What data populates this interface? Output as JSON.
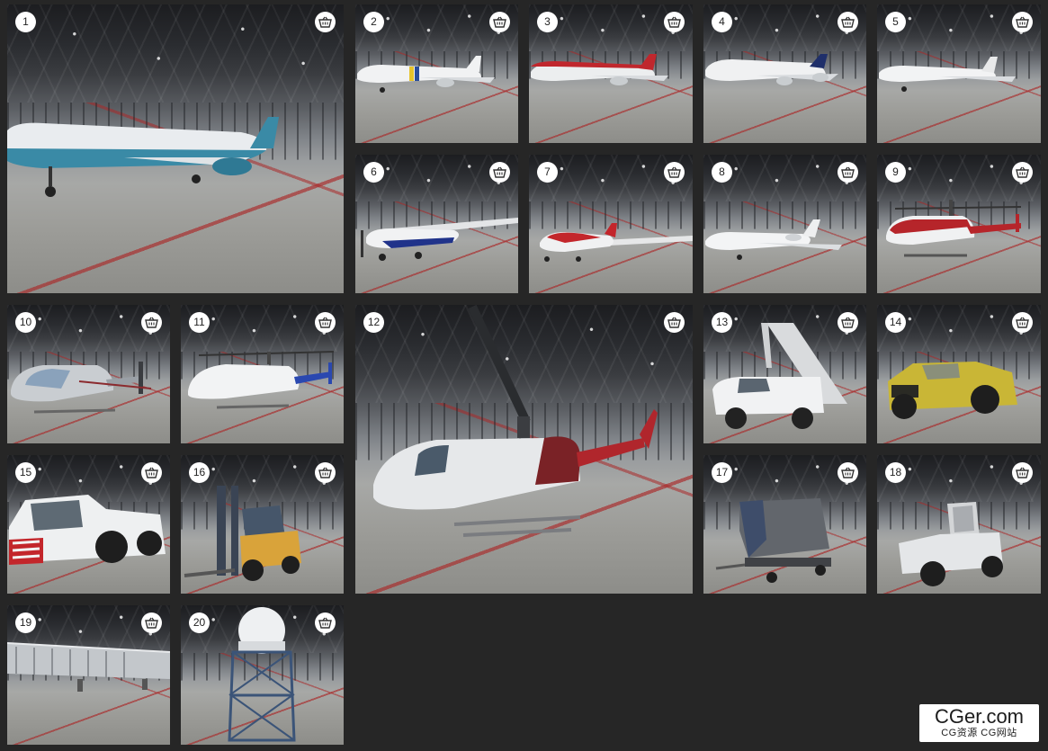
{
  "gallery": {
    "items": [
      {
        "number": "1",
        "subject": "airliner-blue"
      },
      {
        "number": "2",
        "subject": "airliner-yellow-stripe"
      },
      {
        "number": "3",
        "subject": "airliner-red"
      },
      {
        "number": "4",
        "subject": "airliner-a380"
      },
      {
        "number": "5",
        "subject": "airliner-white"
      },
      {
        "number": "6",
        "subject": "propeller-plane-blue"
      },
      {
        "number": "7",
        "subject": "sport-plane-red"
      },
      {
        "number": "8",
        "subject": "business-jet"
      },
      {
        "number": "9",
        "subject": "helicopter-red"
      },
      {
        "number": "10",
        "subject": "helicopter-silver"
      },
      {
        "number": "11",
        "subject": "helicopter-white-blue"
      },
      {
        "number": "12",
        "subject": "helicopter-twin-blade"
      },
      {
        "number": "13",
        "subject": "airstairs-truck"
      },
      {
        "number": "14",
        "subject": "aircraft-tug-yellow"
      },
      {
        "number": "15",
        "subject": "aircraft-tug-white"
      },
      {
        "number": "16",
        "subject": "forklift"
      },
      {
        "number": "17",
        "subject": "baggage-container-cart"
      },
      {
        "number": "18",
        "subject": "baggage-tractor"
      },
      {
        "number": "19",
        "subject": "jet-bridge"
      },
      {
        "number": "20",
        "subject": "radar-tower"
      }
    ],
    "cart_icon": "basket-icon"
  },
  "watermark": {
    "main": "CGer.com",
    "sub": "CG资源 CG网站"
  },
  "colors": {
    "background": "#262626",
    "badge_bg": "#ffffff",
    "floor_stripe": "#aa2828"
  }
}
